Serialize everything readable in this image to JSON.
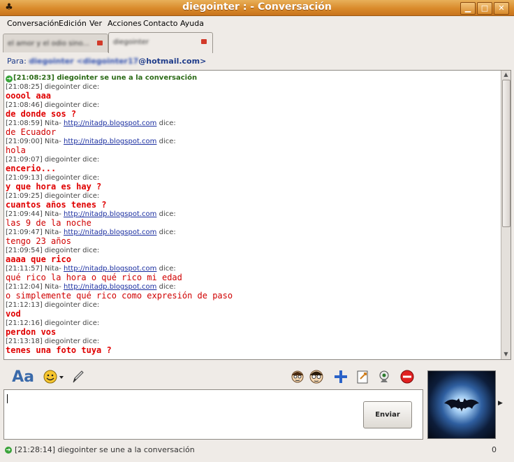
{
  "window": {
    "title": "diegointer :   - Conversación",
    "minimize": "▁",
    "maximize": "□",
    "close": "✕"
  },
  "menu": [
    "Conversación",
    "Edición",
    "Ver",
    "Acciones",
    "Contacto",
    "Ayuda"
  ],
  "tabs": [
    {
      "label": "el amor y el odio sino..."
    },
    {
      "label": "diegointer"
    }
  ],
  "to": {
    "label": "Para:",
    "contact_hidden": "diegointer <diegointer17",
    "email_suffix": "@hotmail.com>"
  },
  "conversation": {
    "join": "[21:08:23] diegointer se une a la conversación",
    "messages": [
      {
        "time": "[21:08:25]",
        "who": "diegointer dice:",
        "link": "",
        "text": "ooool aaa",
        "style": "bold"
      },
      {
        "time": "[21:08:46]",
        "who": "diegointer dice:",
        "link": "",
        "text": "de donde sos ?",
        "style": "bold"
      },
      {
        "time": "[21:08:59]",
        "who": "Nita-",
        "link": "http://nitadp.blogspot.com",
        "who_suffix": "dice:",
        "text": "de Ecuador",
        "style": "normal"
      },
      {
        "time": "[21:09:00]",
        "who": "Nita-",
        "link": "http://nitadp.blogspot.com",
        "who_suffix": "dice:",
        "text": "hola",
        "style": "normal"
      },
      {
        "time": "[21:09:07]",
        "who": "diegointer dice:",
        "link": "",
        "text": "encerio...",
        "style": "bold"
      },
      {
        "time": "[21:09:13]",
        "who": "diegointer dice:",
        "link": "",
        "text": "y que hora es hay ?",
        "style": "bold"
      },
      {
        "time": "[21:09:25]",
        "who": "diegointer dice:",
        "link": "",
        "text": "cuantos años tenes ?",
        "style": "bold"
      },
      {
        "time": "[21:09:44]",
        "who": "Nita-",
        "link": "http://nitadp.blogspot.com",
        "who_suffix": "dice:",
        "text": "las 9 de la noche",
        "style": "normal"
      },
      {
        "time": "[21:09:47]",
        "who": "Nita-",
        "link": "http://nitadp.blogspot.com",
        "who_suffix": "dice:",
        "text": "tengo 23 años",
        "style": "normal"
      },
      {
        "time": "[21:09:54]",
        "who": "diegointer dice:",
        "link": "",
        "text": "aaaa que rico",
        "style": "bold"
      },
      {
        "time": "[21:11:57]",
        "who": "Nita-",
        "link": "http://nitadp.blogspot.com",
        "who_suffix": "dice:",
        "text": "qué rico la hora o qué rico mi edad",
        "style": "normal"
      },
      {
        "time": "[21:12:04]",
        "who": "Nita-",
        "link": "http://nitadp.blogspot.com",
        "who_suffix": "dice:",
        "text": "o simplemente qué rico como expresión de paso",
        "style": "normal"
      },
      {
        "time": "[21:12:13]",
        "who": "diegointer dice:",
        "link": "",
        "text": "vod",
        "style": "bold"
      },
      {
        "time": "[21:12:16]",
        "who": "diegointer dice:",
        "link": "",
        "text": "perdon vos",
        "style": "bold"
      },
      {
        "time": "[21:13:18]",
        "who": "diegointer dice:",
        "link": "",
        "text": "tenes una foto tuya ?",
        "style": "bold"
      }
    ]
  },
  "input": {
    "value": "",
    "send_label": "Enviar"
  },
  "toolbar": {
    "font_label": "Aa"
  },
  "status": {
    "text": "[21:28:14] diegointer se une a la conversación",
    "count": "0"
  }
}
